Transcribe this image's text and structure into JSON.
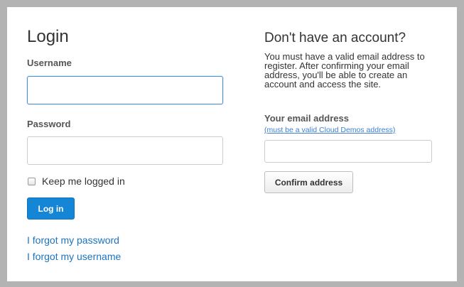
{
  "login": {
    "title": "Login",
    "username_label": "Username",
    "username_value": "",
    "password_label": "Password",
    "password_value": "",
    "remember_label": "Keep me logged in",
    "remember_checked": false,
    "login_button": "Log in",
    "forgot_password": "I forgot my password",
    "forgot_username": "I forgot my username"
  },
  "register": {
    "title": "Don't have an account?",
    "description_lines": [
      "You must have a valid email address to",
      "register. After confirming your email",
      "address, you'll be able to create an",
      "account and access the site."
    ],
    "email_label": "Your email address",
    "email_hint": "(must be a valid Cloud Demos address)",
    "email_value": "",
    "confirm_button": "Confirm address"
  },
  "colors": {
    "primary_button": "#1586d6",
    "link": "#1a74c1",
    "focus_border": "#4a8fd8",
    "frame": "#b3b3b3"
  }
}
